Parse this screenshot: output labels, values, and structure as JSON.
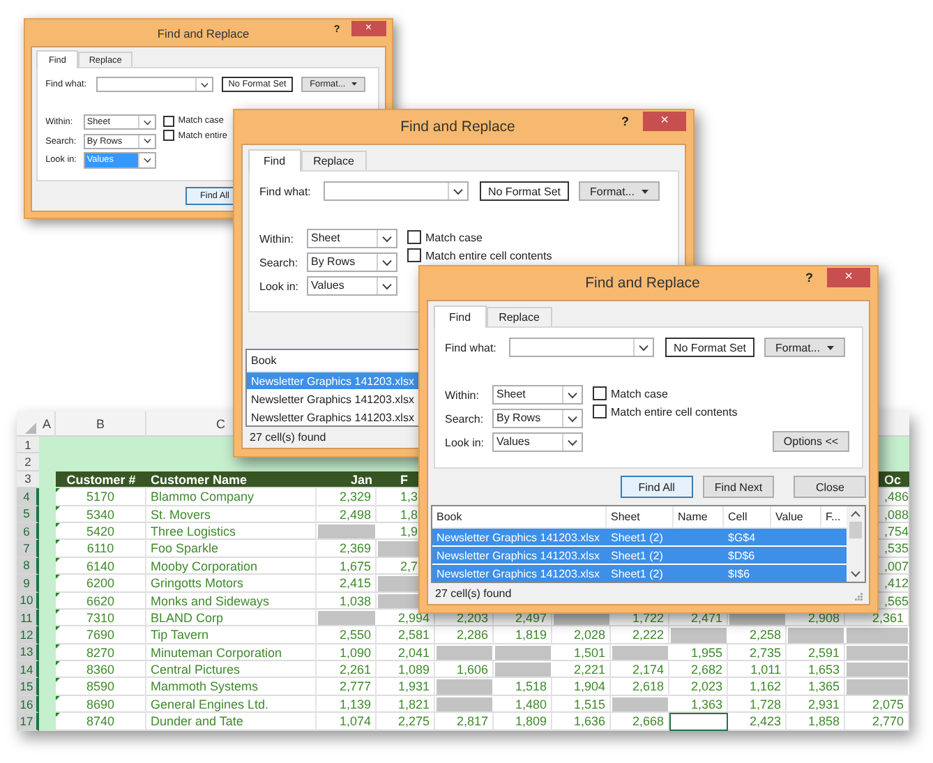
{
  "dialogs": [
    {
      "title": "Find and Replace",
      "help": "?",
      "close": "×",
      "tabs": [
        {
          "label": "Find",
          "selected": true
        },
        {
          "label": "Replace",
          "selected": false
        }
      ],
      "find_what": "Find what:",
      "format_status": "No Format Set",
      "format_button": "Format...",
      "selects": [
        {
          "label": "Within:",
          "value": "Sheet",
          "highlighted": false
        },
        {
          "label": "Search:",
          "value": "By Rows",
          "highlighted": false
        },
        {
          "label": "Look in:",
          "value": "Values",
          "highlighted": true
        }
      ],
      "options": [
        {
          "label": "Match case",
          "checked": false
        },
        {
          "label": "Match entire",
          "checked": false
        }
      ],
      "buttons": [
        {
          "label": "Find All",
          "highlighted": true
        }
      ]
    },
    {
      "title": "Find and Replace",
      "help": "?",
      "close": "×",
      "tabs": [
        {
          "label": "Find",
          "selected": true
        },
        {
          "label": "Replace",
          "selected": false
        }
      ],
      "find_what": "Find what:",
      "format_status": "No Format Set",
      "format_button": "Format...",
      "selects": [
        {
          "label": "Within:",
          "value": "Sheet",
          "highlighted": false
        },
        {
          "label": "Search:",
          "value": "By Rows",
          "highlighted": false
        },
        {
          "label": "Look in:",
          "value": "Values",
          "highlighted": false
        }
      ],
      "options": [
        {
          "label": "Match case",
          "checked": false
        },
        {
          "label": "Match entire cell contents",
          "checked": false
        }
      ],
      "results": {
        "columns": [
          "Book"
        ],
        "rows": [
          {
            "book": "Newsletter Graphics 141203.xlsx",
            "selected": true
          },
          {
            "book": "Newsletter Graphics 141203.xlsx",
            "selected": false
          },
          {
            "book": "Newsletter Graphics 141203.xlsx",
            "selected": false
          }
        ]
      },
      "status": "27 cell(s) found"
    },
    {
      "title": "Find and Replace",
      "help": "?",
      "close": "×",
      "tabs": [
        {
          "label": "Find",
          "selected": true
        },
        {
          "label": "Replace",
          "selected": false
        }
      ],
      "find_what": "Find what:",
      "format_status": "No Format Set",
      "format_button": "Format...",
      "selects": [
        {
          "label": "Within:",
          "value": "Sheet",
          "highlighted": false
        },
        {
          "label": "Search:",
          "value": "By Rows",
          "highlighted": false
        },
        {
          "label": "Look in:",
          "value": "Values",
          "highlighted": false
        }
      ],
      "options": [
        {
          "label": "Match case",
          "checked": false
        },
        {
          "label": "Match entire cell contents",
          "checked": false
        }
      ],
      "options_button": "Options <<",
      "buttons": [
        {
          "label": "Find All",
          "highlighted": true
        },
        {
          "label": "Find Next",
          "highlighted": false
        },
        {
          "label": "Close",
          "highlighted": false
        }
      ],
      "results": {
        "columns": [
          "Book",
          "Sheet",
          "Name",
          "Cell",
          "Value",
          "F..."
        ],
        "rows": [
          {
            "book": "Newsletter Graphics 141203.xlsx",
            "sheet": "Sheet1 (2)",
            "cell": "$G$4",
            "selected": true
          },
          {
            "book": "Newsletter Graphics 141203.xlsx",
            "sheet": "Sheet1 (2)",
            "cell": "$D$6",
            "selected": true
          },
          {
            "book": "Newsletter Graphics 141203.xlsx",
            "sheet": "Sheet1 (2)",
            "cell": "$I$6",
            "selected": true
          }
        ]
      },
      "status": "27 cell(s) found"
    }
  ],
  "spreadsheet": {
    "column_headers": [
      {
        "label": "A",
        "kind": "value"
      },
      {
        "label": "B",
        "kind": "value"
      },
      {
        "label": "C",
        "kind": "cut"
      }
    ],
    "row_headers": [
      {
        "label": "1",
        "selected": false
      },
      {
        "label": "2",
        "selected": false
      },
      {
        "label": "3",
        "selected": false
      },
      {
        "label": "4",
        "selected": true
      },
      {
        "label": "5",
        "selected": true
      },
      {
        "label": "6",
        "selected": true
      },
      {
        "label": "7",
        "selected": true
      },
      {
        "label": "8",
        "selected": true
      },
      {
        "label": "9",
        "selected": true
      },
      {
        "label": "10",
        "selected": true
      },
      {
        "label": "11",
        "selected": true
      },
      {
        "label": "12",
        "selected": true
      },
      {
        "label": "13",
        "selected": true
      },
      {
        "label": "14",
        "selected": true
      },
      {
        "label": "15",
        "selected": true
      },
      {
        "label": "16",
        "selected": true
      },
      {
        "label": "17",
        "selected": true
      }
    ],
    "table": {
      "header": [
        {
          "text": "Customer #",
          "kind": "value"
        },
        {
          "text": "Customer Name",
          "kind": "value"
        },
        {
          "text": "Jan",
          "kind": "value"
        },
        {
          "text": "F",
          "kind": "cut"
        },
        {
          "kind": "covered"
        },
        {
          "kind": "covered"
        },
        {
          "kind": "covered"
        },
        {
          "kind": "covered"
        },
        {
          "kind": "covered"
        },
        {
          "kind": "covered"
        },
        {
          "kind": "covered"
        },
        {
          "text": "Oc",
          "kind": "cut"
        }
      ],
      "rows": [
        {
          "flagged": true,
          "cells": [
            {
              "text": "5170",
              "kind": "value"
            },
            {
              "text": "Blammo Company",
              "kind": "value"
            },
            {
              "text": "2,329",
              "kind": "value"
            },
            {
              "text": "1,3",
              "kind": "cut"
            },
            {
              "kind": "covered"
            },
            {
              "kind": "covered"
            },
            {
              "kind": "covered"
            },
            {
              "kind": "covered"
            },
            {
              "kind": "covered"
            },
            {
              "kind": "covered"
            },
            {
              "kind": "covered"
            },
            {
              "text": ",486",
              "kind": "cut"
            }
          ]
        },
        {
          "flagged": true,
          "cells": [
            {
              "text": "5340",
              "kind": "value"
            },
            {
              "text": "St. Movers",
              "kind": "value"
            },
            {
              "text": "2,498",
              "kind": "value"
            },
            {
              "text": "1,8",
              "kind": "cut"
            },
            {
              "kind": "covered"
            },
            {
              "kind": "covered"
            },
            {
              "kind": "covered"
            },
            {
              "kind": "covered"
            },
            {
              "kind": "covered"
            },
            {
              "kind": "covered"
            },
            {
              "kind": "covered"
            },
            {
              "text": ",088",
              "kind": "cut"
            }
          ]
        },
        {
          "flagged": true,
          "cells": [
            {
              "text": "5420",
              "kind": "value"
            },
            {
              "text": "Three Logistics",
              "kind": "value"
            },
            {
              "kind": "blank"
            },
            {
              "text": "1,9",
              "kind": "cut"
            },
            {
              "kind": "covered"
            },
            {
              "kind": "covered"
            },
            {
              "kind": "covered"
            },
            {
              "kind": "covered"
            },
            {
              "kind": "covered"
            },
            {
              "kind": "covered"
            },
            {
              "kind": "covered"
            },
            {
              "text": ",754",
              "kind": "cut"
            }
          ]
        },
        {
          "flagged": true,
          "cells": [
            {
              "text": "6110",
              "kind": "value"
            },
            {
              "text": "Foo Sparkle",
              "kind": "value"
            },
            {
              "text": "2,369",
              "kind": "value"
            },
            {
              "kind": "blank"
            },
            {
              "kind": "covered"
            },
            {
              "kind": "covered"
            },
            {
              "kind": "covered"
            },
            {
              "kind": "covered"
            },
            {
              "kind": "covered"
            },
            {
              "kind": "covered"
            },
            {
              "kind": "covered"
            },
            {
              "text": ",535",
              "kind": "cut"
            }
          ]
        },
        {
          "flagged": true,
          "cells": [
            {
              "text": "6140",
              "kind": "value"
            },
            {
              "text": "Mooby Corporation",
              "kind": "value"
            },
            {
              "text": "1,675",
              "kind": "value"
            },
            {
              "text": "2,7",
              "kind": "cut"
            },
            {
              "kind": "covered"
            },
            {
              "kind": "covered"
            },
            {
              "kind": "covered"
            },
            {
              "kind": "covered"
            },
            {
              "kind": "covered"
            },
            {
              "kind": "covered"
            },
            {
              "kind": "covered"
            },
            {
              "text": ",007",
              "kind": "cut"
            }
          ]
        },
        {
          "flagged": true,
          "cells": [
            {
              "text": "6200",
              "kind": "value"
            },
            {
              "text": "Gringotts Motors",
              "kind": "value"
            },
            {
              "text": "2,415",
              "kind": "value"
            },
            {
              "kind": "blank"
            },
            {
              "kind": "covered"
            },
            {
              "kind": "covered"
            },
            {
              "kind": "covered"
            },
            {
              "kind": "covered"
            },
            {
              "kind": "covered"
            },
            {
              "kind": "covered"
            },
            {
              "kind": "covered"
            },
            {
              "text": ",412",
              "kind": "cut"
            }
          ]
        },
        {
          "flagged": true,
          "cells": [
            {
              "text": "6620",
              "kind": "value"
            },
            {
              "text": "Monks and Sideways",
              "kind": "value"
            },
            {
              "text": "1,038",
              "kind": "value"
            },
            {
              "kind": "blank"
            },
            {
              "kind": "covered"
            },
            {
              "kind": "covered"
            },
            {
              "kind": "covered"
            },
            {
              "kind": "covered"
            },
            {
              "kind": "covered"
            },
            {
              "kind": "covered"
            },
            {
              "kind": "covered"
            },
            {
              "text": ",565",
              "kind": "cut"
            }
          ]
        },
        {
          "flagged": true,
          "cells": [
            {
              "text": "7310",
              "kind": "value"
            },
            {
              "text": "BLAND Corp",
              "kind": "value"
            },
            {
              "kind": "blank"
            },
            {
              "text": "2,994",
              "kind": "value"
            },
            {
              "text": "2,203",
              "kind": "value"
            },
            {
              "text": "2,497",
              "kind": "value"
            },
            {
              "kind": "blank"
            },
            {
              "text": "1,722",
              "kind": "value"
            },
            {
              "text": "2,471",
              "kind": "value"
            },
            {
              "kind": "blank"
            },
            {
              "text": "2,908",
              "kind": "value"
            },
            {
              "text": "2,361",
              "kind": "value"
            }
          ]
        },
        {
          "flagged": true,
          "cells": [
            {
              "text": "7690",
              "kind": "value"
            },
            {
              "text": "Tip Tavern",
              "kind": "value"
            },
            {
              "text": "2,550",
              "kind": "value"
            },
            {
              "text": "2,581",
              "kind": "value"
            },
            {
              "text": "2,286",
              "kind": "value"
            },
            {
              "text": "1,819",
              "kind": "value"
            },
            {
              "text": "2,028",
              "kind": "value"
            },
            {
              "text": "2,222",
              "kind": "value"
            },
            {
              "kind": "blank"
            },
            {
              "text": "2,258",
              "kind": "value"
            },
            {
              "kind": "blank"
            },
            {
              "kind": "blank"
            }
          ]
        },
        {
          "flagged": true,
          "cells": [
            {
              "text": "8270",
              "kind": "value"
            },
            {
              "text": "Minuteman Corporation",
              "kind": "value"
            },
            {
              "text": "1,090",
              "kind": "value"
            },
            {
              "text": "2,041",
              "kind": "value"
            },
            {
              "kind": "blank"
            },
            {
              "kind": "blank"
            },
            {
              "text": "1,501",
              "kind": "value"
            },
            {
              "kind": "blank"
            },
            {
              "text": "1,955",
              "kind": "value"
            },
            {
              "text": "2,735",
              "kind": "value"
            },
            {
              "text": "2,591",
              "kind": "value"
            },
            {
              "kind": "blank"
            }
          ]
        },
        {
          "flagged": true,
          "cells": [
            {
              "text": "8360",
              "kind": "value"
            },
            {
              "text": "Central Pictures",
              "kind": "value"
            },
            {
              "text": "2,261",
              "kind": "value"
            },
            {
              "text": "1,089",
              "kind": "value"
            },
            {
              "text": "1,606",
              "kind": "value"
            },
            {
              "kind": "blank"
            },
            {
              "text": "2,221",
              "kind": "value"
            },
            {
              "text": "2,174",
              "kind": "value"
            },
            {
              "text": "2,682",
              "kind": "value"
            },
            {
              "text": "1,011",
              "kind": "value"
            },
            {
              "text": "1,653",
              "kind": "value"
            },
            {
              "kind": "blank"
            }
          ]
        },
        {
          "flagged": true,
          "cells": [
            {
              "text": "8590",
              "kind": "value"
            },
            {
              "text": "Mammoth Systems",
              "kind": "value"
            },
            {
              "text": "2,777",
              "kind": "value"
            },
            {
              "text": "1,931",
              "kind": "value"
            },
            {
              "kind": "blank"
            },
            {
              "text": "1,518",
              "kind": "value"
            },
            {
              "text": "1,904",
              "kind": "value"
            },
            {
              "text": "2,618",
              "kind": "value"
            },
            {
              "text": "2,023",
              "kind": "value"
            },
            {
              "text": "1,162",
              "kind": "value"
            },
            {
              "text": "1,365",
              "kind": "value"
            },
            {
              "kind": "blank"
            }
          ]
        },
        {
          "flagged": true,
          "cells": [
            {
              "text": "8690",
              "kind": "value"
            },
            {
              "text": "General Engines Ltd.",
              "kind": "value"
            },
            {
              "text": "1,139",
              "kind": "value"
            },
            {
              "text": "1,821",
              "kind": "value"
            },
            {
              "kind": "blank"
            },
            {
              "text": "1,480",
              "kind": "value"
            },
            {
              "text": "1,515",
              "kind": "value"
            },
            {
              "kind": "blank"
            },
            {
              "text": "1,363",
              "kind": "value"
            },
            {
              "text": "1,728",
              "kind": "value"
            },
            {
              "text": "2,931",
              "kind": "value"
            },
            {
              "text": "2,075",
              "kind": "value"
            }
          ]
        },
        {
          "flagged": true,
          "cells": [
            {
              "text": "8740",
              "kind": "value"
            },
            {
              "text": "Dunder and Tate",
              "kind": "value"
            },
            {
              "text": "1,074",
              "kind": "value"
            },
            {
              "text": "2,275",
              "kind": "value"
            },
            {
              "text": "2,817",
              "kind": "value"
            },
            {
              "text": "1,809",
              "kind": "value"
            },
            {
              "text": "1,636",
              "kind": "value"
            },
            {
              "text": "2,668",
              "kind": "value"
            },
            {
              "kind": "active"
            },
            {
              "text": "2,423",
              "kind": "value"
            },
            {
              "text": "1,858",
              "kind": "value"
            },
            {
              "text": "2,770",
              "kind": "value"
            }
          ]
        }
      ]
    }
  }
}
